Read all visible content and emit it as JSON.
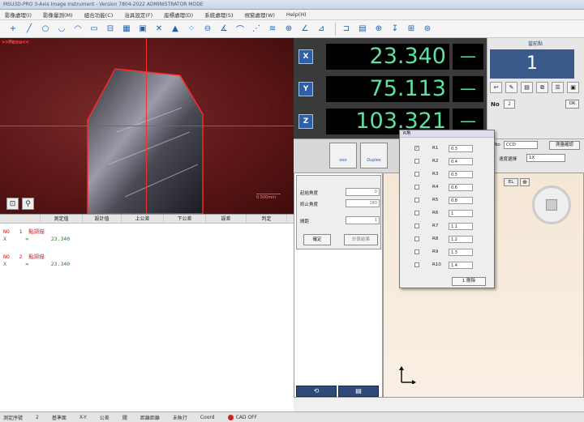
{
  "window": {
    "title": "MSU3D-PRO 3-Axis Image Instrument - Version 7804-2022 ADMINISTRATOR MODE"
  },
  "menu": [
    "影像處理(I)",
    "影像量測(M)",
    "組合功能(C)",
    "治具設定(F)",
    "座標處理(D)",
    "系統處理(S)",
    "視窗處理(W)",
    "Help(H)"
  ],
  "camera": {
    "menu_label": ">>Menu<<",
    "scale_text": "0.500mm"
  },
  "results": {
    "columns": [
      "測定值",
      "設計值",
      "上公差",
      "下公差",
      "誤差",
      "判定"
    ],
    "rows": [
      {
        "no": "NO   1  點掃描",
        "axis": "X      =       23.340"
      },
      {
        "no": "NO   2  點掃描",
        "axis": "X      =       23.340"
      }
    ]
  },
  "dro": {
    "x": {
      "label": "X",
      "value": "23.340",
      "dash": "—"
    },
    "y": {
      "label": "Y",
      "value": "75.113",
      "dash": "—"
    },
    "z": {
      "label": "Z",
      "value": "103.321",
      "dash": "—"
    }
  },
  "right_panel": {
    "title": "當前點",
    "count": "1",
    "no_label": "No",
    "no_value": "2",
    "ok": "OK",
    "pno_label": "P.No",
    "pno_value": "CCD",
    "measure_btn": "測量確認",
    "speed_label": "速度選擇",
    "speed_value": "1X",
    "el": "EL"
  },
  "mid": {
    "btn1": "ooo",
    "btn2": "Duplex"
  },
  "angle": {
    "start_label": "起始角度",
    "start_value": "0",
    "end_label": "終止角度",
    "end_value": "180",
    "gap_label": "間距",
    "gap_value": "1",
    "confirm": "確定",
    "cancel": "計算結果"
  },
  "r_popup": {
    "title": "R角",
    "rows": [
      {
        "label": "R1",
        "value": "0.3"
      },
      {
        "label": "R2",
        "value": "0.4"
      },
      {
        "label": "R3",
        "value": "0.5"
      },
      {
        "label": "R4",
        "value": "0.6"
      },
      {
        "label": "R5",
        "value": "0.8"
      },
      {
        "label": "R6",
        "value": "1"
      },
      {
        "label": "R7",
        "value": "1.1"
      },
      {
        "label": "R8",
        "value": "1.2"
      },
      {
        "label": "R9",
        "value": "1.3"
      },
      {
        "label": "R10",
        "value": "1.4"
      }
    ],
    "button": "1 刪除"
  },
  "status": [
    "測定序號",
    "2",
    "基準面",
    "X-Y",
    "公差",
    "關",
    "距離距離",
    "未執行",
    "Coord",
    "CAD OFF"
  ]
}
